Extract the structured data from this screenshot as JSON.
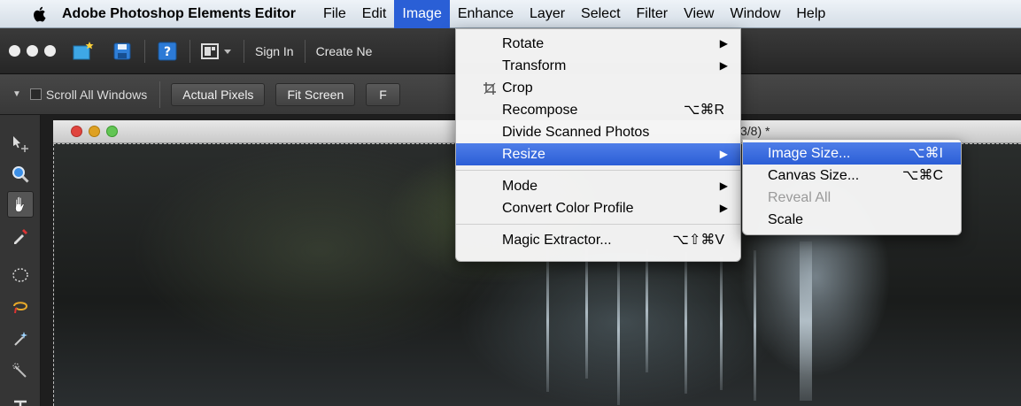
{
  "menubar": {
    "app_name": "Adobe Photoshop Elements Editor",
    "items": [
      "File",
      "Edit",
      "Image",
      "Enhance",
      "Layer",
      "Select",
      "Filter",
      "View",
      "Window",
      "Help"
    ],
    "active": "Image"
  },
  "toolbar": {
    "sign_in": "Sign In",
    "create_new": "Create Ne"
  },
  "options": {
    "scroll_all": "Scroll All Windows",
    "actual_pixels": "Actual Pixels",
    "fit_screen": "Fit Screen",
    "cut_button": "F"
  },
  "document": {
    "title_fragment": "3/8) *"
  },
  "image_menu": {
    "rotate": "Rotate",
    "transform": "Transform",
    "crop": "Crop",
    "recompose": "Recompose",
    "recompose_shortcut": "⌥⌘R",
    "divide_scanned": "Divide Scanned Photos",
    "resize": "Resize",
    "mode": "Mode",
    "convert_color": "Convert Color Profile",
    "magic_extractor": "Magic Extractor...",
    "magic_extractor_shortcut": "⌥⇧⌘V"
  },
  "resize_menu": {
    "image_size": "Image Size...",
    "image_size_shortcut": "⌥⌘I",
    "canvas_size": "Canvas Size...",
    "canvas_size_shortcut": "⌥⌘C",
    "reveal_all": "Reveal All",
    "scale": "Scale"
  },
  "colors": {
    "highlight": "#2a5fd6",
    "menu_bg": "#f5f5f5",
    "toolbar_bg": "#2e2e2e"
  }
}
